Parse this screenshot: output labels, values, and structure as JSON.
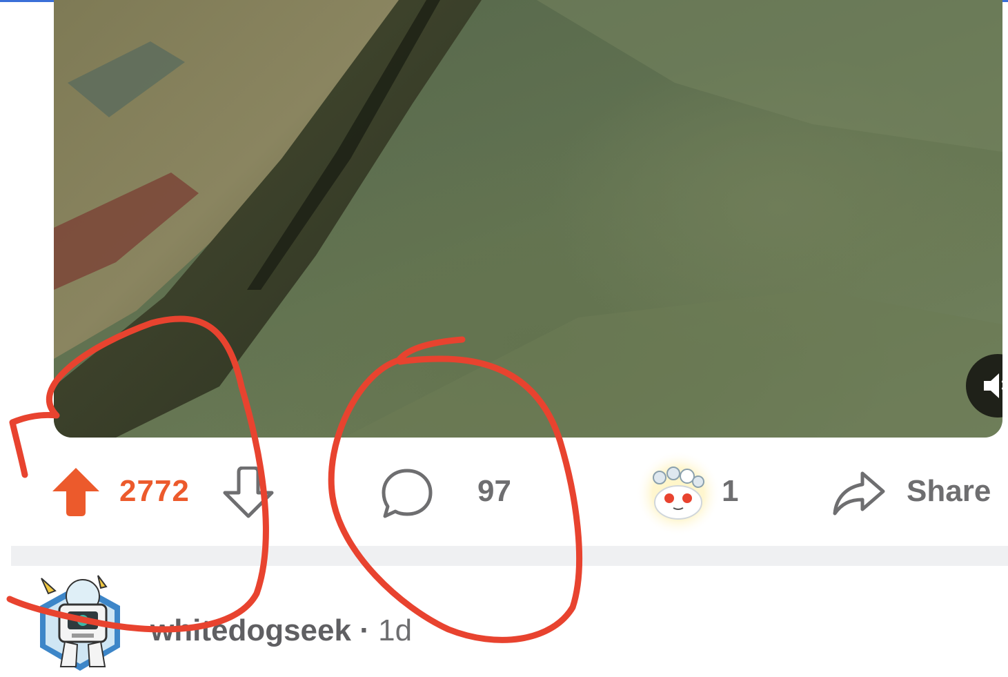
{
  "post": {
    "score": "2772",
    "comment_count": "97",
    "award_count": "1",
    "share_label": "Share"
  },
  "comment": {
    "username": "whitedogseek",
    "separator": "·",
    "age": "1d"
  },
  "colors": {
    "upvote_active": "#ec5a2c",
    "annotation_red": "#e8432f",
    "muted_text": "#6e6e70",
    "media_background": "#5f7050"
  },
  "icons": {
    "media": [
      "mute-icon"
    ],
    "actions": [
      "upvote-arrow-icon",
      "downvote-arrow-icon",
      "comment-bubble-icon",
      "award-icon",
      "share-arrow-icon"
    ],
    "comment": [
      "avatar"
    ]
  }
}
